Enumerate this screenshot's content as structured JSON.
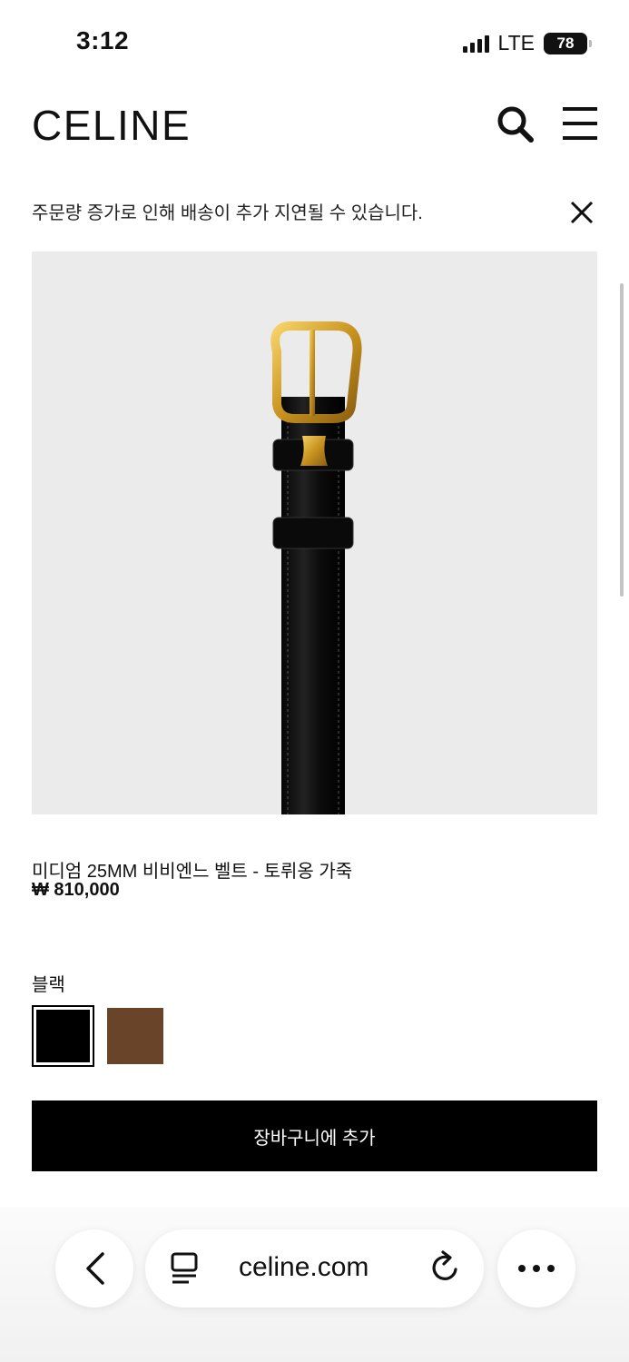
{
  "status_bar": {
    "time": "3:12",
    "network": "LTE",
    "battery": "78"
  },
  "header": {
    "logo": "CELINE",
    "icons": [
      "search-icon",
      "menu-icon"
    ]
  },
  "notice": {
    "text": "주문량 증가로 인해 배송이 추가 지연될 수 있습니다."
  },
  "product": {
    "name": "미디엄 25MM 비비엔느 벨트 - 토뤼옹 가죽",
    "price": "₩ 810,000",
    "color_label": "블랙",
    "swatches": [
      {
        "name": "black",
        "color": "#000000",
        "selected": true
      },
      {
        "name": "brown",
        "color": "#6a4428",
        "selected": false
      }
    ],
    "add_to_cart": "장바구니에 추가"
  },
  "browser": {
    "url": "celine.com"
  },
  "colors": {
    "accent": "#000000",
    "image_bg": "#ebebeb",
    "gold": "#d4a32a"
  }
}
